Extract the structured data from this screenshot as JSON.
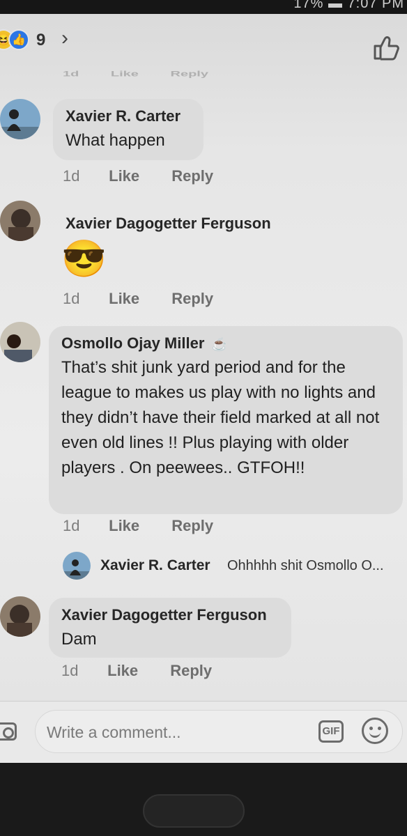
{
  "status_bar": {
    "text": "17% ▬ 7:07 PM"
  },
  "reactions": {
    "count": "9",
    "emoji_haha": "😆",
    "emoji_like": "👍",
    "chevron": "›"
  },
  "ghost_row": {
    "time": "1d",
    "like": "Like",
    "reply": "Reply"
  },
  "comments": [
    {
      "name": "Xavier R. Carter",
      "text": "What happen",
      "time": "1d",
      "like": "Like",
      "reply": "Reply"
    },
    {
      "name": "Xavier Dagogetter Ferguson",
      "text": "😎",
      "time": "1d",
      "like": "Like",
      "reply": "Reply"
    },
    {
      "name": "Osmollo Ojay Miller",
      "name_icon": "☕",
      "text": "That’s shit junk yard period and for the league to makes us play with no lights and they didn’t have their field marked at all not even old lines !! Plus playing with older players . On peewees.. GTFOH!!",
      "time": "1d",
      "like": "Like",
      "reply": "Reply"
    },
    {
      "name": "Xavier Dagogetter Ferguson",
      "text": "Dam",
      "time": "1d",
      "like": "Like",
      "reply": "Reply"
    }
  ],
  "reply_preview": {
    "name": "Xavier R. Carter",
    "text": "Ohhhhh shit Osmollo O..."
  },
  "composer": {
    "placeholder": "Write a comment...",
    "gif_label": "GIF"
  },
  "colors": {
    "bubble": "#dcdcdc",
    "like_blue": "#2b76e5",
    "haha_yellow": "#f2c12b"
  }
}
